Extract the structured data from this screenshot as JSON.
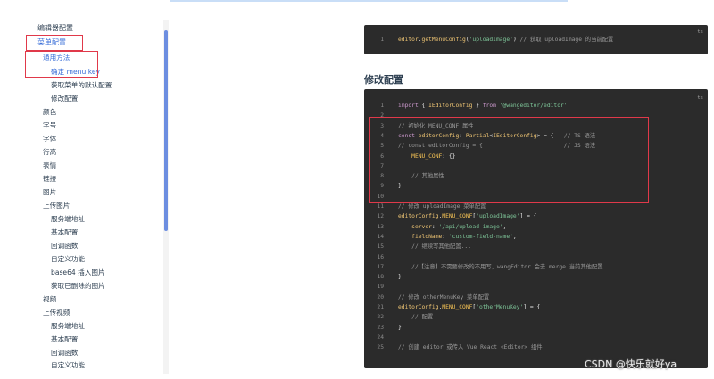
{
  "sidebar": {
    "items": [
      {
        "label": "编辑器配置",
        "level": 0
      },
      {
        "label": "菜单配置",
        "level": 0,
        "active": true
      },
      {
        "label": "通用方法",
        "level": 1,
        "link": true
      },
      {
        "label": "确定 menu key",
        "level": 2,
        "link": true
      },
      {
        "label": "获取菜单的默认配置",
        "level": 2
      },
      {
        "label": "修改配置",
        "level": 2
      },
      {
        "label": "颜色",
        "level": 1
      },
      {
        "label": "字号",
        "level": 1
      },
      {
        "label": "字体",
        "level": 1
      },
      {
        "label": "行高",
        "level": 1
      },
      {
        "label": "表情",
        "level": 1
      },
      {
        "label": "链接",
        "level": 1
      },
      {
        "label": "图片",
        "level": 1
      },
      {
        "label": "上传图片",
        "level": 1
      },
      {
        "label": "服务端地址",
        "level": 2
      },
      {
        "label": "基本配置",
        "level": 2
      },
      {
        "label": "回调函数",
        "level": 2
      },
      {
        "label": "自定义功能",
        "level": 2
      },
      {
        "label": "base64 插入图片",
        "level": 2
      },
      {
        "label": "获取已删除的图片",
        "level": 2
      },
      {
        "label": "视频",
        "level": 1
      },
      {
        "label": "上传视频",
        "level": 1
      },
      {
        "label": "服务端地址",
        "level": 2
      },
      {
        "label": "基本配置",
        "level": 2
      },
      {
        "label": "回调函数",
        "level": 2
      },
      {
        "label": "自定义功能",
        "level": 2
      }
    ]
  },
  "code1": {
    "lang": "ts",
    "lines": [
      [
        [
          "fn",
          "editor"
        ],
        [
          "",
          "."
        ],
        [
          "fn",
          "getMenuConfig"
        ],
        [
          "",
          "("
        ],
        [
          "str",
          "'uploadImage'"
        ],
        [
          "",
          ") "
        ],
        [
          "cm",
          "// 获取 uploadImage 的当前配置"
        ]
      ]
    ]
  },
  "section_title": "修改配置",
  "code2": {
    "lang": "ts",
    "lines": [
      [
        [
          "kw",
          "import"
        ],
        [
          "",
          " { "
        ],
        [
          "fn",
          "IEditorConfig"
        ],
        [
          "",
          " } "
        ],
        [
          "kw",
          "from"
        ],
        [
          "",
          " "
        ],
        [
          "str",
          "'@wangeditor/editor'"
        ]
      ],
      [],
      [
        [
          "cm",
          "// 初始化 MENU_CONF 属性"
        ]
      ],
      [
        [
          "kw",
          "const"
        ],
        [
          "",
          " "
        ],
        [
          "fn",
          "editorConfig"
        ],
        [
          "",
          ": "
        ],
        [
          "fn",
          "Partial"
        ],
        [
          "",
          "<"
        ],
        [
          "fn",
          "IEditorConfig"
        ],
        [
          "",
          "> = {   "
        ],
        [
          "cm",
          "// TS 语法"
        ]
      ],
      [
        [
          "cm",
          "// const editorConfig = {                        // JS 语法"
        ]
      ],
      [
        [
          "",
          "    "
        ],
        [
          "prop",
          "MENU_CONF"
        ],
        [
          "",
          ": {}"
        ]
      ],
      [],
      [
        [
          "",
          "    "
        ],
        [
          "cm",
          "// 其他属性..."
        ]
      ],
      [
        [
          "",
          "}"
        ]
      ],
      [],
      [
        [
          "cm",
          "// 修改 uploadImage 菜单配置"
        ]
      ],
      [
        [
          "fn",
          "editorConfig"
        ],
        [
          "",
          "."
        ],
        [
          "prop",
          "MENU_CONF"
        ],
        [
          "",
          "["
        ],
        [
          "str",
          "'uploadImage'"
        ],
        [
          "",
          "] = {"
        ]
      ],
      [
        [
          "",
          "    "
        ],
        [
          "fn",
          "server"
        ],
        [
          "",
          ": "
        ],
        [
          "str",
          "'/api/upload-image'"
        ],
        [
          "",
          ","
        ]
      ],
      [
        [
          "",
          "    "
        ],
        [
          "fn",
          "fieldName"
        ],
        [
          "",
          ": "
        ],
        [
          "str",
          "'custom-field-name'"
        ],
        [
          "",
          ","
        ]
      ],
      [
        [
          "",
          "    "
        ],
        [
          "cm",
          "// 继续写其他配置..."
        ]
      ],
      [],
      [
        [
          "",
          "    "
        ],
        [
          "cm",
          "//【注意】不需要修改的不用写，wangEditor 会去 merge 当前其他配置"
        ]
      ],
      [
        [
          "",
          "}"
        ]
      ],
      [],
      [
        [
          "cm",
          "// 修改 otherMenuKey 菜单配置"
        ]
      ],
      [
        [
          "fn",
          "editorConfig"
        ],
        [
          "",
          "."
        ],
        [
          "prop",
          "MENU_CONF"
        ],
        [
          "",
          "["
        ],
        [
          "str",
          "'otherMenuKey'"
        ],
        [
          "",
          "] = {"
        ]
      ],
      [
        [
          "",
          "    "
        ],
        [
          "cm",
          "// 配置"
        ]
      ],
      [
        [
          "",
          "}"
        ]
      ],
      [],
      [
        [
          "cm",
          "// 创建 editor 或传入 Vue React <Editor> 组件"
        ]
      ]
    ]
  },
  "watermark": "CSDN @快乐就好ya",
  "colors": {
    "accent": "#3a6fd8",
    "highlight_box": "#e0394a",
    "code_bg": "#2b2b2b"
  }
}
